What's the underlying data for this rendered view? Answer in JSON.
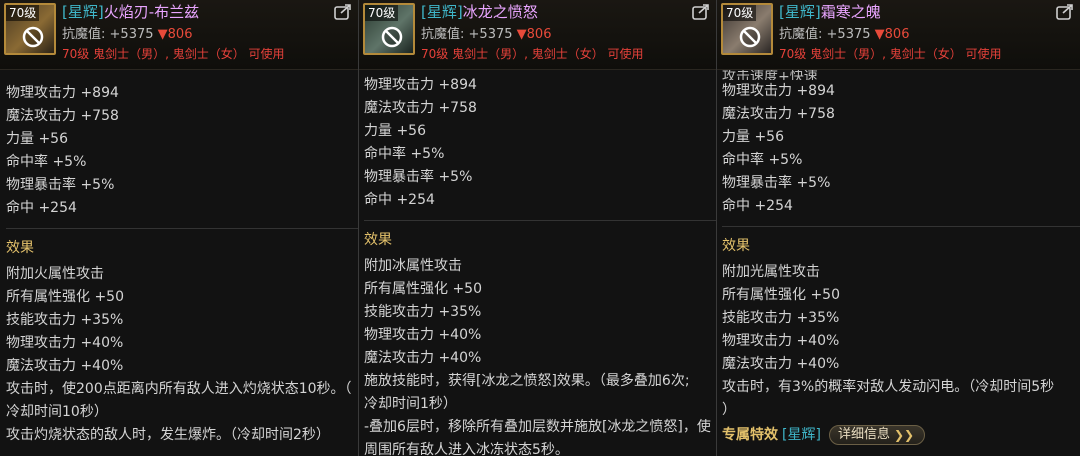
{
  "panels": [
    {
      "level": "70级",
      "tag": "[星辉]",
      "name": "火焰刃-布兰兹",
      "res_label": "抗魔值:",
      "res_value": "+5375",
      "res_down": "▼806",
      "requirement": "70级 鬼剑士（男）, 鬼剑士（女） 可使用",
      "stats": [
        "物理攻击力 +894",
        "魔法攻击力 +758",
        "力量 +56",
        "命中率 +5%",
        "物理暴击率 +5%",
        "命中 +254"
      ],
      "effects_title": "效果",
      "effects": [
        "附加火属性攻击",
        "所有属性强化 +50",
        "技能攻击力 +35%",
        "物理攻击力 +40%",
        "魔法攻击力 +40%"
      ],
      "effect_long_1": "攻击时，使200点距离内所有敌人进入灼烧状态10秒。（",
      "effect_long_2": "冷却时间10秒）",
      "effect_long_3": "攻击灼烧状态的敌人时，发生爆炸。（冷却时间2秒）"
    },
    {
      "level": "70级",
      "tag": "[星辉]",
      "name": "冰龙之愤怒",
      "res_label": "抗魔值:",
      "res_value": "+5375",
      "res_down": "▼806",
      "requirement": "70级 鬼剑士（男）, 鬼剑士（女） 可使用",
      "stats": [
        "物理攻击力 +894",
        "魔法攻击力 +758",
        "力量 +56",
        "命中率 +5%",
        "物理暴击率 +5%",
        "命中 +254"
      ],
      "effects_title": "效果",
      "effects": [
        "附加冰属性攻击",
        "所有属性强化 +50",
        "技能攻击力 +35%",
        "物理攻击力 +40%",
        "魔法攻击力 +40%"
      ],
      "effect_long_1": "施放技能时，获得[冰龙之愤怒]效果。（最多叠加6次;",
      "effect_long_2": "冷却时间1秒）",
      "effect_long_3": "-叠加6层时，移除所有叠加层数并施放[冰龙之愤怒]，使",
      "effect_long_4": "周围所有敌人进入冰冻状态5秒。"
    },
    {
      "level": "70级",
      "tag": "[星辉]",
      "name": "霜寒之魄",
      "res_label": "抗魔值:",
      "res_value": "+5375",
      "res_down": "▼806",
      "requirement": "70级 鬼剑士（男）, 鬼剑士（女） 可使用",
      "cut_line": "攻击速度+快速",
      "stats": [
        "物理攻击力 +894",
        "魔法攻击力 +758",
        "力量 +56",
        "命中率 +5%",
        "物理暴击率 +5%",
        "命中 +254"
      ],
      "effects_title": "效果",
      "effects": [
        "附加光属性攻击",
        "所有属性强化 +50",
        "技能攻击力 +35%",
        "物理攻击力 +40%",
        "魔法攻击力 +40%"
      ],
      "effect_long_1": "攻击时，有3%的概率对敌人发动闪电。（冷却时间5秒",
      "effect_long_2": "）",
      "exclusive_label": "专属特效",
      "exclusive_tag": "[星辉]",
      "detail_button": "详细信息"
    }
  ],
  "icons": {
    "ban": "no-use-icon",
    "share": "share-icon",
    "chevron": "double-chevron-right-icon"
  },
  "colors": {
    "tag": "#3fb6c9",
    "item_name": "#e9a5ff",
    "requirement": "#e5413a",
    "section": "#e3c16b"
  }
}
